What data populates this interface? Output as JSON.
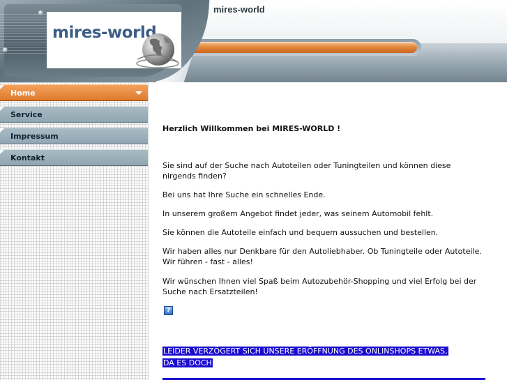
{
  "header": {
    "site_title": "mires-world",
    "logo_text": "mires-world",
    "colors": {
      "accent_orange": "#de7a2d",
      "steel": "#7d8e99",
      "logo_blue": "#3c5d86"
    }
  },
  "nav": {
    "items": [
      {
        "label": "Home",
        "active": true
      },
      {
        "label": "Service",
        "active": false
      },
      {
        "label": "Impressum",
        "active": false
      },
      {
        "label": "Kontakt",
        "active": false
      }
    ]
  },
  "main": {
    "welcome": "Herzlich Willkommen bei MIRES-WORLD !",
    "paragraphs": [
      "Sie sind auf der Suche nach Autoteilen oder Tuningteilen und können diese nirgends finden?",
      "Bei uns hat Ihre Suche ein schnelles Ende.",
      "In unserem großem Angebot findet jeder, was seinem Automobil fehlt.",
      "Sie können die Autoteile einfach und bequem aussuchen und bestellen.",
      "Wir haben alles nur Denkbare für den Autoliebhaber. Ob Tuningteile oder Autoteile. Wir führen - fast - alles!",
      "Wir wünschen Ihnen viel Spaß beim Autozubehör-Shopping und viel Erfolg bei der Suche nach Ersatzteilen!"
    ],
    "help_icon": "?",
    "notice_line1": "LEIDER VERZÖGERT SICH UNSERE ERÖFFNUNG DES ONLINSHOPS ETWAS,",
    "notice_line2": "DA ES DOCH",
    "notice_color": "#1a0ccf"
  }
}
